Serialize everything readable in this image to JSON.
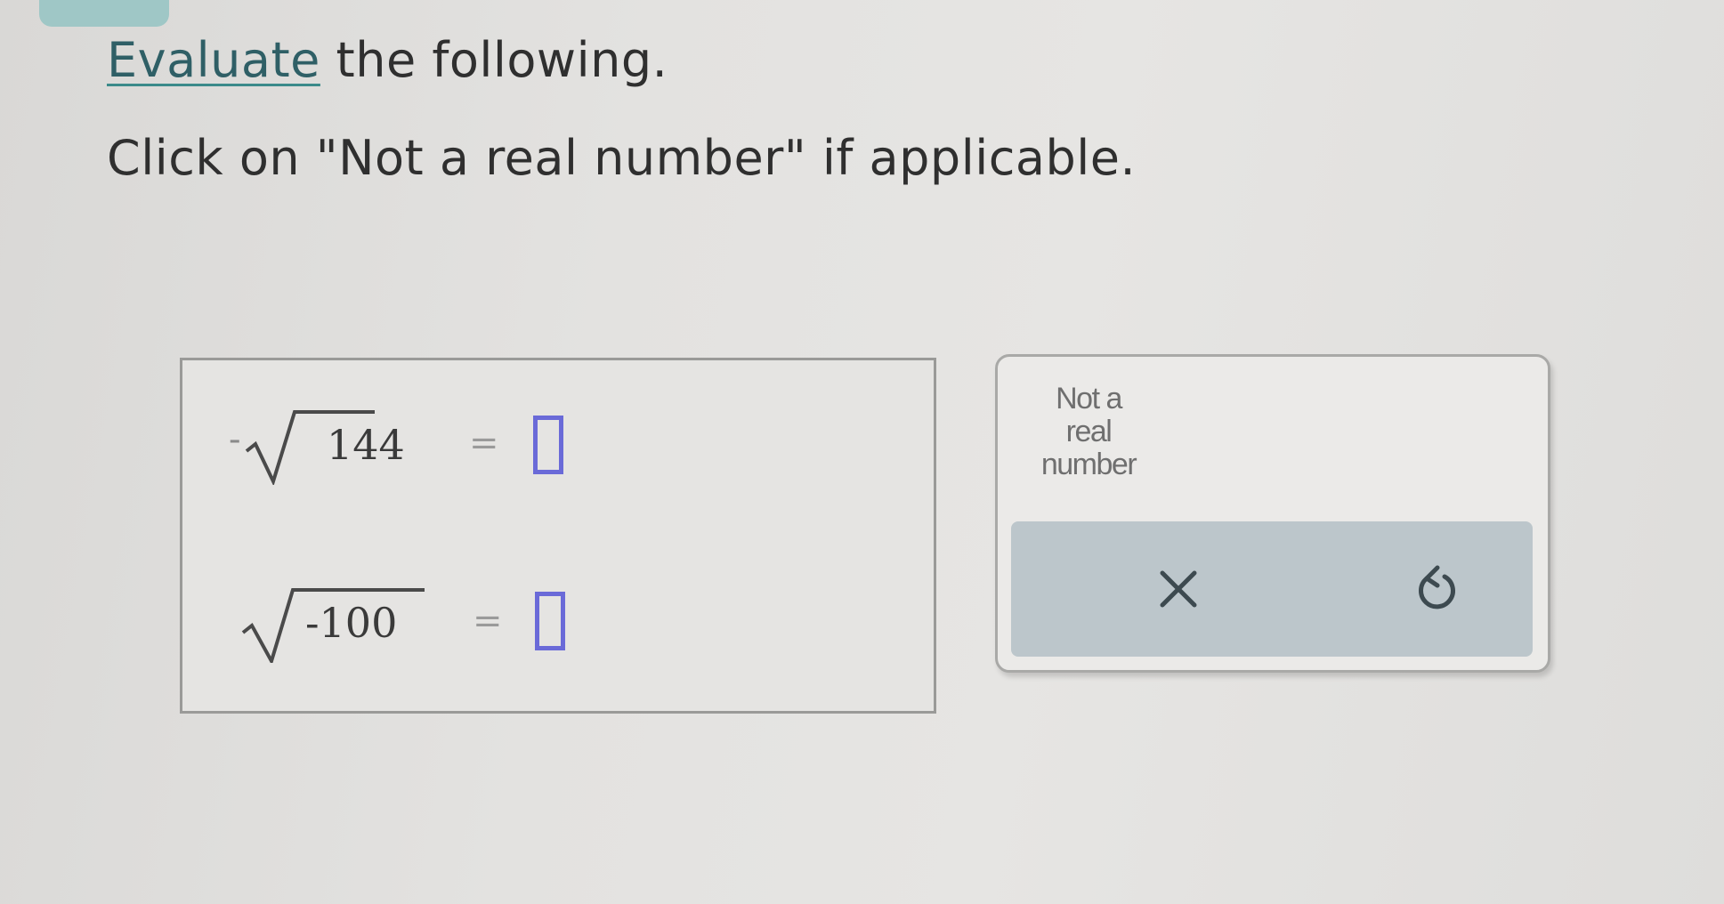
{
  "instructions": {
    "line1_link": "Evaluate",
    "line1_rest": " the following.",
    "line2": "Click on \"Not a real number\" if applicable."
  },
  "problems": [
    {
      "sign": "-",
      "radicand": "144",
      "equals": "="
    },
    {
      "sign": "",
      "radicand": "-100",
      "equals": "="
    }
  ],
  "tools": {
    "not_real_lines": [
      "Not a",
      "real",
      "number"
    ],
    "clear_icon": "x-icon",
    "reset_icon": "undo-icon"
  },
  "colors": {
    "answer_box_border": "#6a6ad8",
    "link_color": "#2f5f66",
    "action_bar": "#bcc6cb"
  }
}
